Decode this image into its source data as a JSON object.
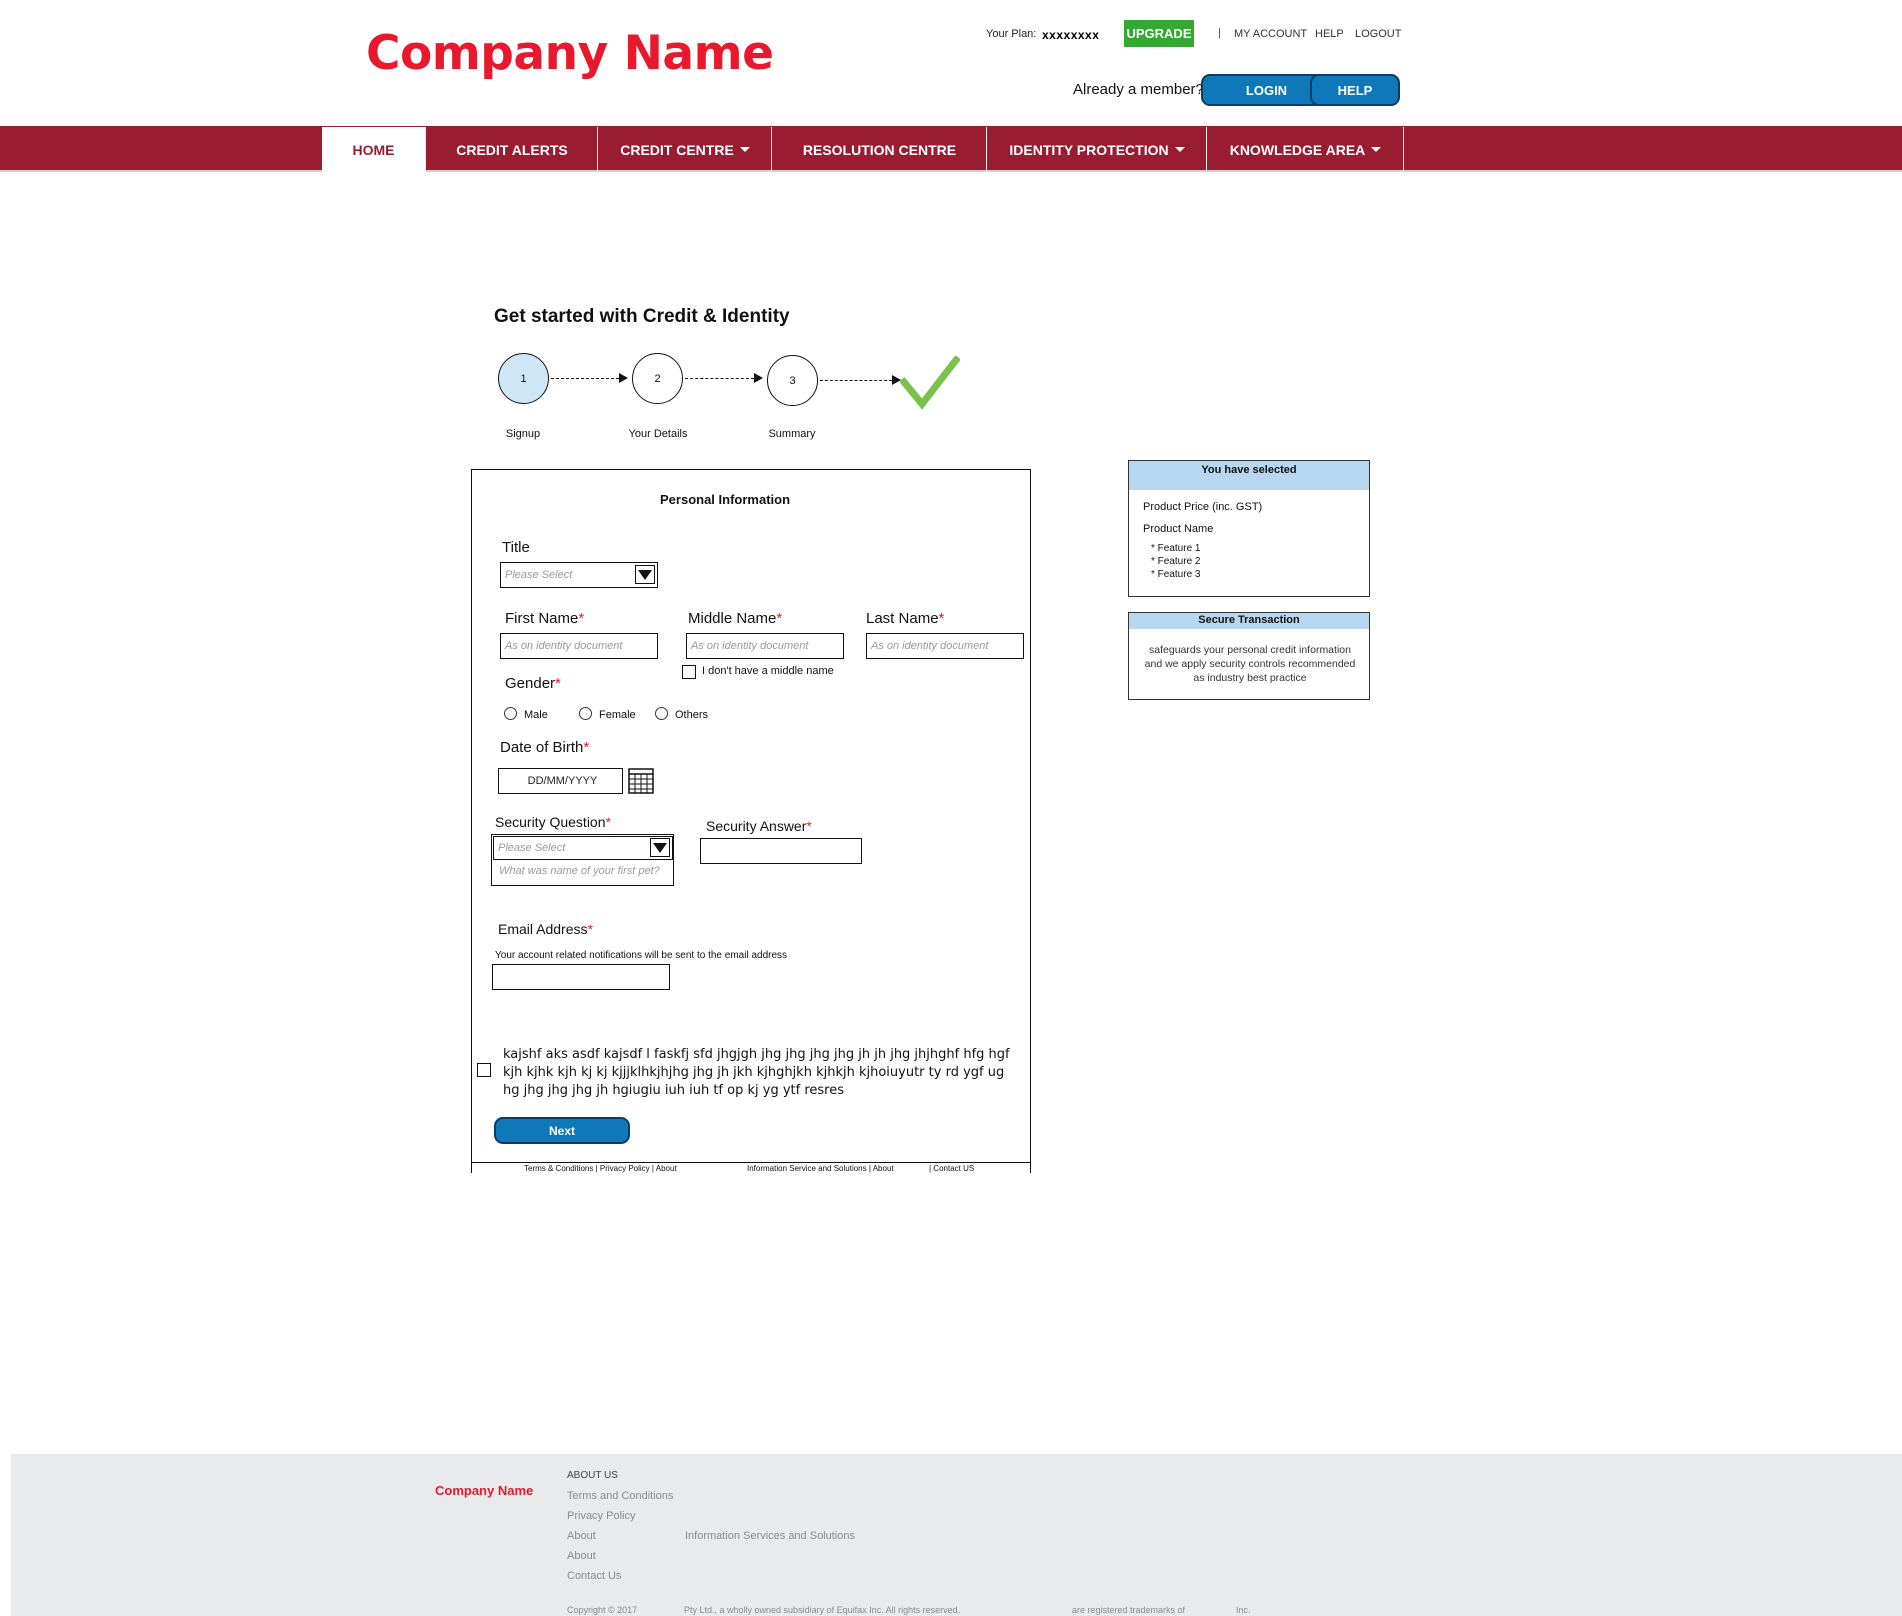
{
  "header": {
    "logo": "Company Name",
    "plan_label": "Your Plan:",
    "plan_value": "xxxxxxxx",
    "upgrade_label": "UPGRADE",
    "separator": "|",
    "links": [
      "MY ACCOUNT",
      "HELP",
      "LOGOUT"
    ],
    "member_text": "Already a member?",
    "login_label": "LOGIN",
    "help_label": "HELP"
  },
  "nav": {
    "items": [
      {
        "label": "HOME",
        "active": true,
        "dropdown": false
      },
      {
        "label": "CREDIT ALERTS",
        "active": false,
        "dropdown": false
      },
      {
        "label": "CREDIT CENTRE",
        "active": false,
        "dropdown": true
      },
      {
        "label": "RESOLUTION CENTRE",
        "active": false,
        "dropdown": false
      },
      {
        "label": "IDENTITY PROTECTION",
        "active": false,
        "dropdown": true
      },
      {
        "label": "KNOWLEDGE AREA",
        "active": false,
        "dropdown": true
      }
    ]
  },
  "page": {
    "title": "Get started with Credit & Identity"
  },
  "steps": [
    {
      "number": "1",
      "label": "Signup",
      "current": true
    },
    {
      "number": "2",
      "label": "Your Details",
      "current": false
    },
    {
      "number": "3",
      "label": "Summary",
      "current": false
    }
  ],
  "form": {
    "section_title": "Personal Information",
    "required_mark": "*",
    "title_label": "Title",
    "title_placeholder": "Please Select",
    "first_name_label": "First Name",
    "middle_name_label": "Middle Name",
    "last_name_label": "Last Name",
    "name_placeholder": "As on identity document",
    "no_middle_name_label": "I don't have a middle name",
    "gender_label": "Gender",
    "gender_options": [
      "Male",
      "Female",
      "Others"
    ],
    "dob_label": "Date of Birth",
    "dob_placeholder": "DD/MM/YYYY",
    "security_question_label": "Security Question",
    "security_question_placeholder": "Please Select",
    "security_question_option": "What was name of your first pet?",
    "security_answer_label": "Security Answer",
    "email_label": "Email Address",
    "email_help": "Your account related notifications will be sent to the email address",
    "terms_text": "kajshf aks  asdf  kajsdf l faskfj sfd jhgjgh jhg  jhg  jhg jhg jh jh jhg jhjhghf  hfg  hgf kjh kjhk kjh kj kj kjjjklhkjhjhg  jhg jh jkh kjhghjkh kjhkjh kjhoiuyutr ty rd ygf ug hg jhg jhg jhg jh hgiugiu iuh iuh tf op kj  yg ytf resres",
    "next_label": "Next",
    "mini_footer_left": "Terms & Conditions | Privacy Policy | About",
    "mini_footer_mid": "Information Service and Solutions | About",
    "mini_footer_right": "| Contact US"
  },
  "selection_box": {
    "heading": "You have selected",
    "price_label": "Product Price (inc. GST)",
    "product_name": "Product Name",
    "features": [
      "* Feature 1",
      "* Feature 2",
      "* Feature 3"
    ]
  },
  "secure_box": {
    "heading": "Secure Transaction",
    "text": "safeguards your personal credit information and we apply security controls recommended as industry best practice"
  },
  "footer": {
    "logo": "Company Name",
    "about_heading": "ABOUT US",
    "links": [
      "Terms and Conditions",
      "Privacy Policy",
      "About",
      "About",
      "Contact Us"
    ],
    "info_services": "Information Services and Solutions",
    "copyright": "Copyright © 2017",
    "subsidiary": "Pty Ltd., a wholly owned subsidiary of Equifax Inc. All rights reserved.",
    "trademarks": "are registered trademarks of",
    "inc": "Inc."
  },
  "colors": {
    "brand_red": "#e8192c",
    "nav_red": "#9a1c30",
    "button_blue": "#0f78b8",
    "upgrade_green": "#33a833",
    "step_current": "#cfe6f7",
    "box_header": "#b7d7f1",
    "checkmark": "#7cc24a"
  }
}
